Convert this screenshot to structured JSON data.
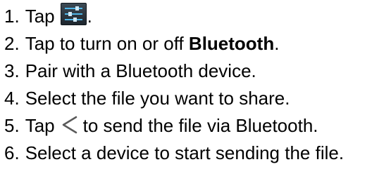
{
  "steps": [
    {
      "number": "1.",
      "pre": "Tap",
      "icon": "settings-sliders-icon",
      "post": "."
    },
    {
      "number": "2.",
      "pre": "Tap to turn on or off ",
      "bold": "Bluetooth",
      "post": "."
    },
    {
      "number": "3.",
      "text": "Pair with a Bluetooth device."
    },
    {
      "number": "4.",
      "text": "Select the file you want to share."
    },
    {
      "number": "5.",
      "pre": "Tap",
      "icon": "share-icon",
      "post": "to send the file via Bluetooth."
    },
    {
      "number": "6.",
      "text": "Select a device to start sending the file."
    }
  ],
  "colors": {
    "text": "#000000",
    "settings_icon_bg": "#2c363f",
    "settings_icon_slider": "#4fb6e8",
    "share_icon": "#5a5a5a"
  }
}
